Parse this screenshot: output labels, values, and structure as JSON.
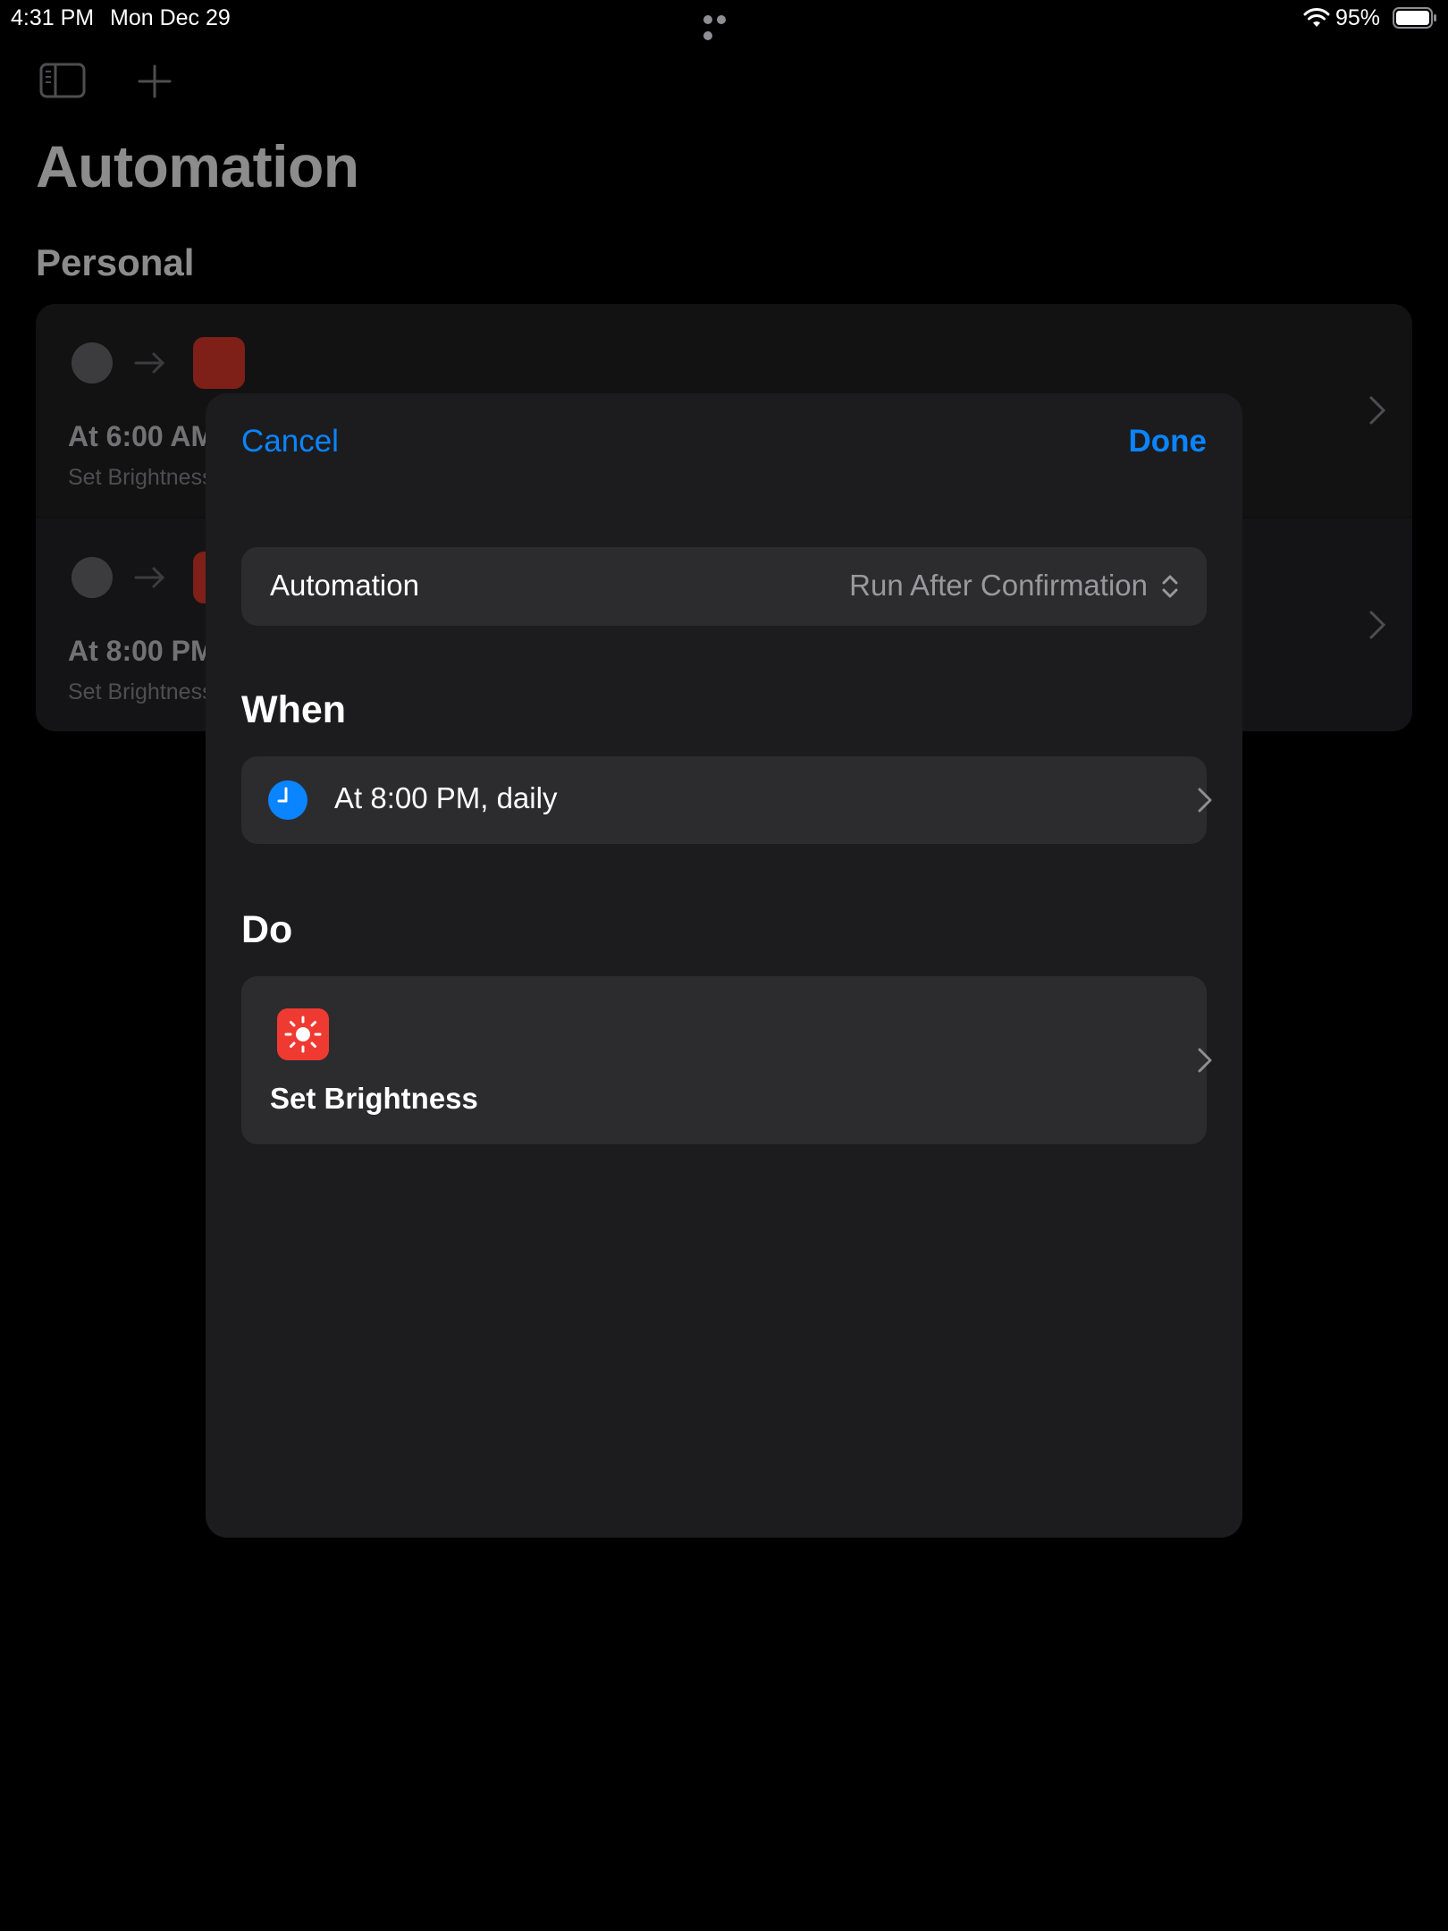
{
  "status_bar": {
    "time": "4:31 PM",
    "date": "Mon Dec 29",
    "battery_percent": "95%",
    "wifi_icon": "wifi-icon",
    "battery_icon": "battery-icon"
  },
  "background": {
    "title": "Automation",
    "section": "Personal",
    "toolbar_icons": [
      "sidebar-icon",
      "plus-icon"
    ],
    "automations": [
      {
        "title": "At 6:00 AM",
        "subtitle": "Set Brightness"
      },
      {
        "title": "At 8:00 PM",
        "subtitle": "Set Brightness"
      }
    ]
  },
  "modal": {
    "cancel_label": "Cancel",
    "done_label": "Done",
    "automation_row": {
      "label": "Automation",
      "value": "Run After Confirmation"
    },
    "when_header": "When",
    "when_row": {
      "label": "At 8:00 PM, daily",
      "icon": "clock-icon"
    },
    "do_header": "Do",
    "do_row": {
      "label": "Set Brightness",
      "icon": "brightness-icon"
    }
  },
  "colors": {
    "accent": "#0a84ff",
    "sheet": "#1c1c1e",
    "row": "#2c2c2e",
    "brightness_app": "#ef3a32"
  }
}
